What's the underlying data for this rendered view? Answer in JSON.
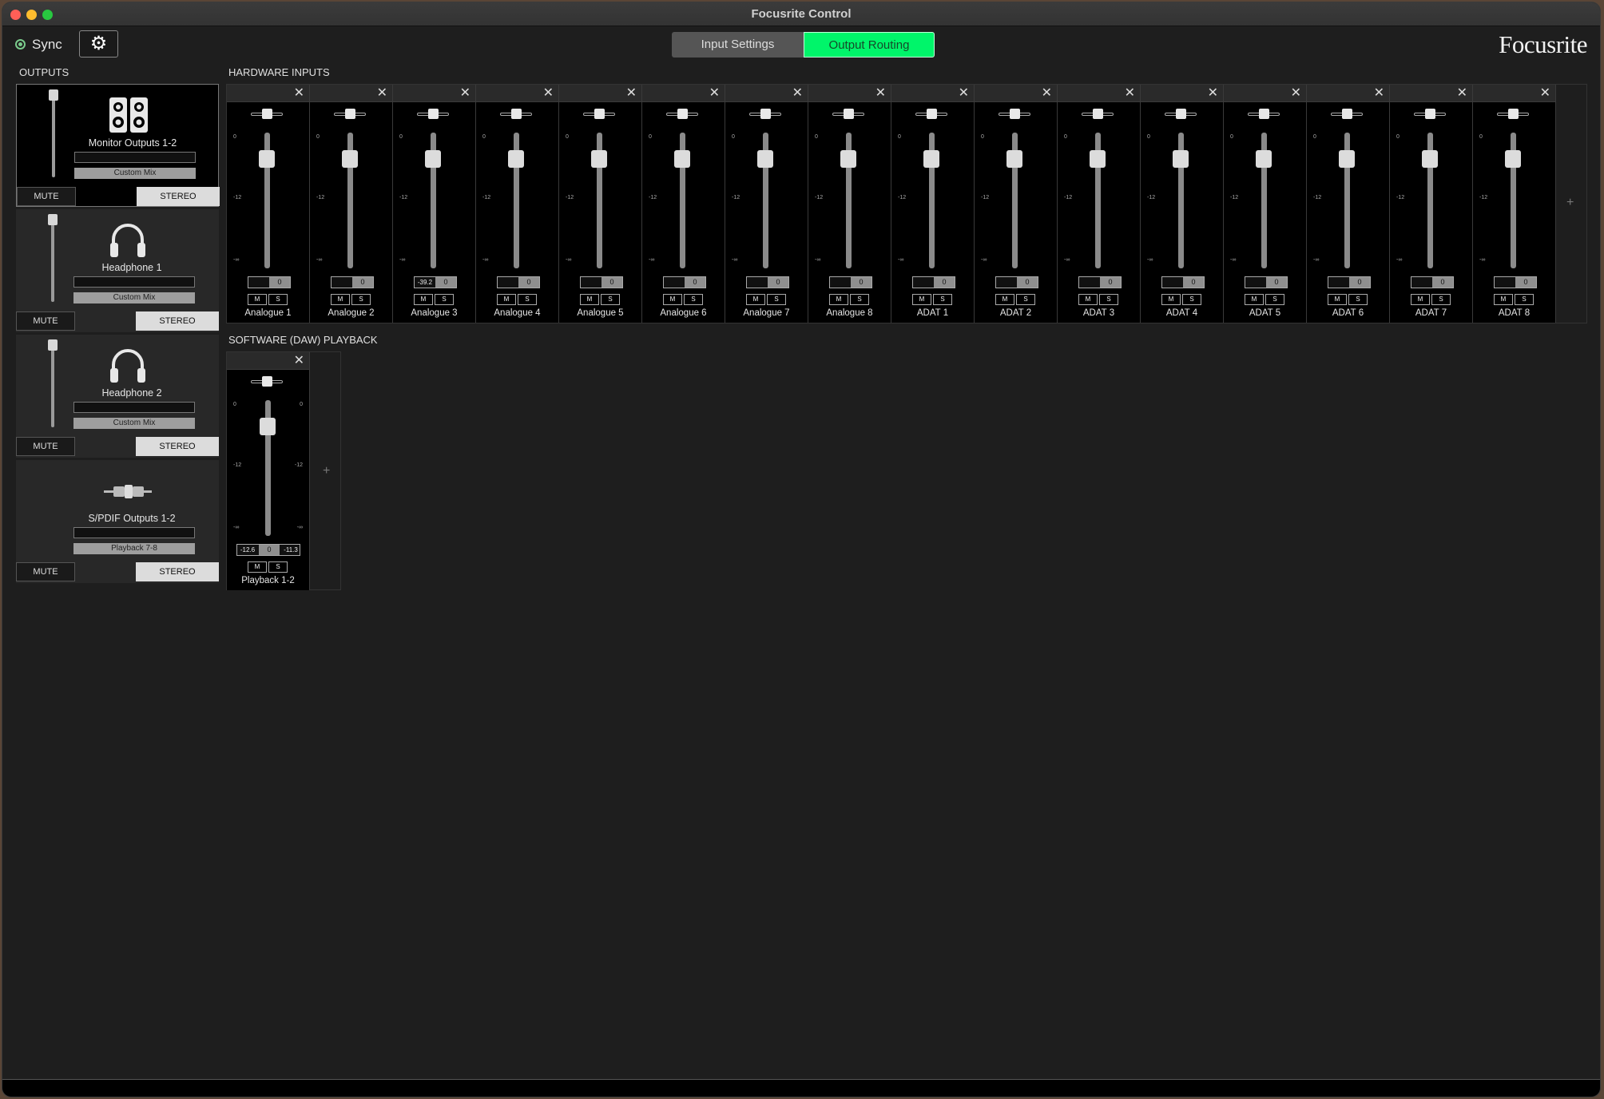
{
  "window": {
    "title": "Focusrite Control"
  },
  "toolbar": {
    "sync_label": "Sync",
    "settings_icon": "gear-icon",
    "tabs": [
      {
        "label": "Input Settings",
        "active": false
      },
      {
        "label": "Output Routing",
        "active": true
      }
    ],
    "logo": "Focusrite",
    "accent_color": "#00f56a"
  },
  "outputs": {
    "heading": "OUTPUTS",
    "items": [
      {
        "name": "Monitor Outputs 1-2",
        "icon": "speakers-icon",
        "source": "Custom Mix",
        "mute": "MUTE",
        "stereo": "STEREO",
        "selected": true
      },
      {
        "name": "Headphone 1",
        "icon": "headphones-icon",
        "source": "Custom Mix",
        "mute": "MUTE",
        "stereo": "STEREO",
        "selected": false
      },
      {
        "name": "Headphone 2",
        "icon": "headphones-icon",
        "source": "Custom Mix",
        "mute": "MUTE",
        "stereo": "STEREO",
        "selected": false
      },
      {
        "name": "S/PDIF Outputs 1-2",
        "icon": "spdif-cable-icon",
        "source": "Playback 7-8",
        "mute": "MUTE",
        "stereo": "STEREO",
        "selected": false
      }
    ]
  },
  "hardware_inputs": {
    "heading": "HARDWARE INPUTS",
    "scale": [
      "0",
      "-12",
      "-∞"
    ],
    "mute_label": "M",
    "solo_label": "S",
    "channels": [
      {
        "name": "Analogue 1",
        "level": "",
        "gain": "0"
      },
      {
        "name": "Analogue 2",
        "level": "",
        "gain": "0"
      },
      {
        "name": "Analogue 3",
        "level": "-39.2",
        "gain": "0"
      },
      {
        "name": "Analogue 4",
        "level": "",
        "gain": "0"
      },
      {
        "name": "Analogue 5",
        "level": "",
        "gain": "0"
      },
      {
        "name": "Analogue 6",
        "level": "",
        "gain": "0"
      },
      {
        "name": "Analogue 7",
        "level": "",
        "gain": "0"
      },
      {
        "name": "Analogue 8",
        "level": "",
        "gain": "0"
      },
      {
        "name": "ADAT 1",
        "level": "",
        "gain": "0"
      },
      {
        "name": "ADAT 2",
        "level": "",
        "gain": "0"
      },
      {
        "name": "ADAT 3",
        "level": "",
        "gain": "0"
      },
      {
        "name": "ADAT 4",
        "level": "",
        "gain": "0"
      },
      {
        "name": "ADAT 5",
        "level": "",
        "gain": "0"
      },
      {
        "name": "ADAT 6",
        "level": "",
        "gain": "0"
      },
      {
        "name": "ADAT 7",
        "level": "",
        "gain": "0"
      },
      {
        "name": "ADAT 8",
        "level": "",
        "gain": "0"
      }
    ]
  },
  "daw_playback": {
    "heading": "SOFTWARE (DAW) PLAYBACK",
    "channels": [
      {
        "name": "Playback 1-2",
        "level_l": "-12.6",
        "gain": "0",
        "level_r": "-11.3"
      }
    ]
  }
}
